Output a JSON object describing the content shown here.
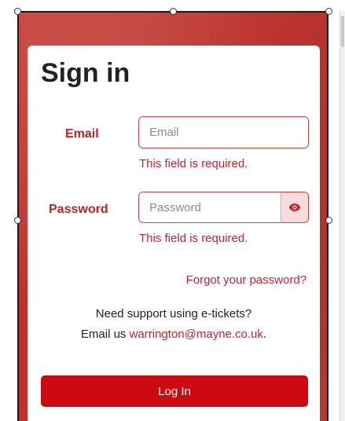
{
  "title": "Sign in",
  "email": {
    "label": "Email",
    "placeholder": "Email",
    "value": "",
    "error": "This field is required."
  },
  "password": {
    "label": "Password",
    "placeholder": "Password",
    "value": "",
    "error": "This field is required.",
    "toggle_icon": "eye-icon"
  },
  "forgot_link": "Forgot your password?",
  "support": {
    "line1": "Need support using e-tickets?",
    "prefix": "Email us ",
    "email": "warrington@mayne.co.uk",
    "suffix": "."
  },
  "login_button": "Log In",
  "colors": {
    "brand_red": "#cc0a12",
    "error_red": "#c0262d",
    "background_red": "#b8312d"
  }
}
